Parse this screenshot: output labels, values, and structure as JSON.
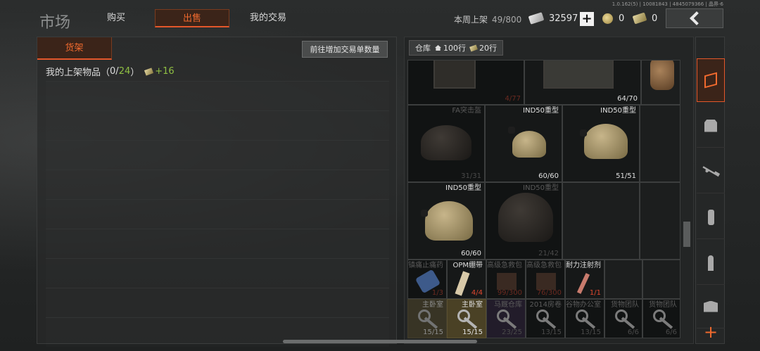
{
  "version": "1.0.162(5) | 10081843 | 4845079366 | 晶界-6",
  "title": "市场",
  "tabs": [
    {
      "label": "购买"
    },
    {
      "label": "出售"
    },
    {
      "label": "我的交易"
    }
  ],
  "weekly": {
    "label": "本周上架",
    "count": "49/800"
  },
  "currency": {
    "cash": "32597",
    "coin": "0",
    "ticket": "0"
  },
  "left": {
    "shelf_tab": "货架",
    "increase_button": "前往增加交易单数量",
    "listed_label": "我的上架物品（",
    "listed_used": "0",
    "listed_sep": "/",
    "listed_total": "24",
    "listed_close": "）",
    "listed_bonus": "+16"
  },
  "warehouse": {
    "label": "仓库",
    "rows": "100行",
    "ticket_rows": "20行"
  },
  "items": {
    "vest_a": {
      "dur": "4/77"
    },
    "vest_b": {
      "dur": "64/70"
    },
    "fa_helmet": {
      "name": "FA突击盔",
      "dur": "31/31"
    },
    "ind50_1": {
      "name": "IND50重型",
      "dur": "60/60"
    },
    "ind50_2": {
      "name": "IND50重型",
      "dur": "51/51"
    },
    "ind50_3": {
      "name": "IND50重型",
      "dur": "60/60"
    },
    "ind50_4": {
      "name": "IND50重型",
      "dur": "21/42"
    },
    "painkiller": {
      "name": "镇痛止痛药",
      "dur": "1/3"
    },
    "opm_bandage": {
      "name": "OPM绷带",
      "dur": "4/4"
    },
    "adv_kit_1": {
      "name": "高级急救包",
      "dur": "99/300"
    },
    "adv_kit_2": {
      "name": "高级急救包",
      "dur": "76/300"
    },
    "stamina_inj": {
      "name": "耐力注射剂",
      "dur": "1/1"
    },
    "key_master_1": {
      "name": "主卧室",
      "dur": "15/15"
    },
    "key_master_2": {
      "name": "主卧室",
      "dur": "15/15"
    },
    "key_horse": {
      "name": "马厩仓库",
      "dur": "23/25"
    },
    "key_2014": {
      "name": "2014房卷",
      "dur": "13/15"
    },
    "key_valley": {
      "name": "谷物办公室",
      "dur": "13/15"
    },
    "key_cargo_1": {
      "name": "货物团队",
      "dur": "6/6"
    },
    "key_cargo_2": {
      "name": "货物团队",
      "dur": "6/6"
    }
  },
  "icons": [
    "cash-icon",
    "coin-icon",
    "ticket-icon",
    "back-arrow-icon",
    "home-icon",
    "helmet-icon",
    "vest-icon",
    "rifle-icon",
    "magazine-icon",
    "ammo-icon",
    "box-icon",
    "plus-icon"
  ],
  "colors": {
    "accent": "#e4572a",
    "accent_text": "#f06a2e",
    "green": "#8fbf43",
    "durability_red": "#e0482f",
    "key_gold": "#4a4125"
  }
}
